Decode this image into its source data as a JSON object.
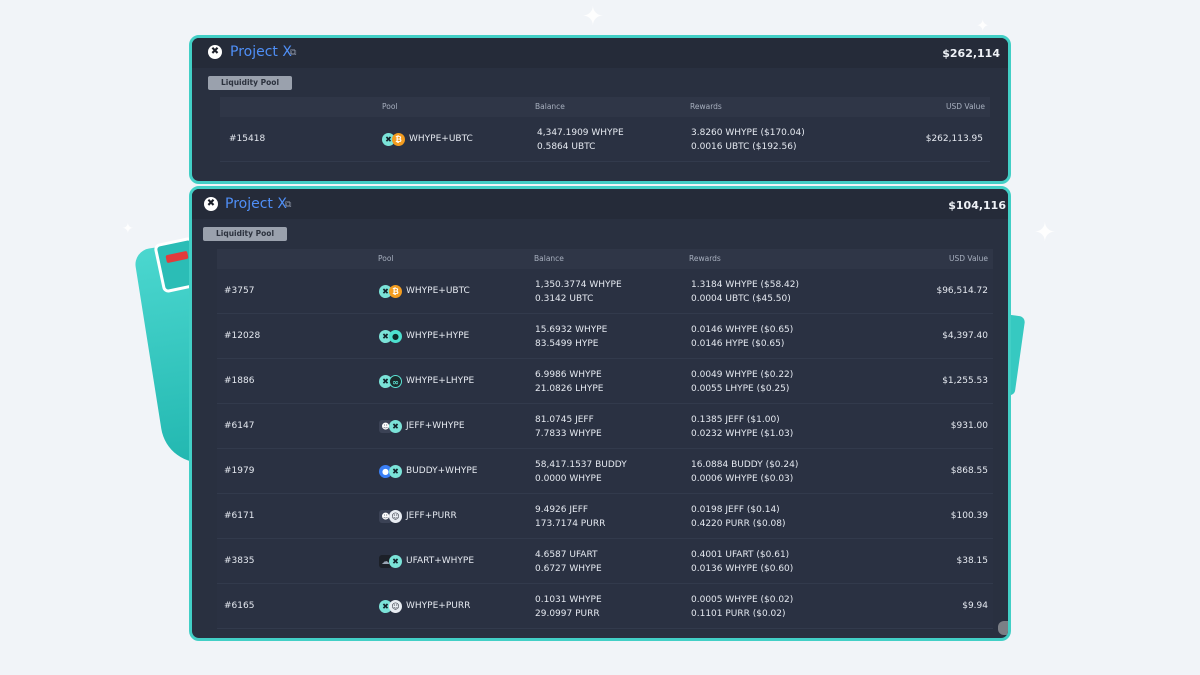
{
  "cards": [
    {
      "project": "Project X",
      "total": "$262,114",
      "section_tag": "Liquidity Pool",
      "columns": {
        "pool": "Pool",
        "balance": "Balance",
        "rewards": "Rewards",
        "usd": "USD Value"
      },
      "rows": [
        {
          "id": "#15418",
          "pool": "WHYPE+UBTC",
          "token_icons": [
            "whype",
            "ubtc"
          ],
          "balance": [
            "4,347.1909 WHYPE",
            "0.5864 UBTC"
          ],
          "rewards": [
            "3.8260 WHYPE ($170.04)",
            "0.0016 UBTC ($192.56)"
          ],
          "usd": "$262,113.95"
        }
      ]
    },
    {
      "project": "Project X",
      "total": "$104,116",
      "section_tag": "Liquidity Pool",
      "columns": {
        "pool": "Pool",
        "balance": "Balance",
        "rewards": "Rewards",
        "usd": "USD Value"
      },
      "rows": [
        {
          "id": "#3757",
          "pool": "WHYPE+UBTC",
          "token_icons": [
            "whype",
            "ubtc"
          ],
          "balance": [
            "1,350.3774 WHYPE",
            "0.3142 UBTC"
          ],
          "rewards": [
            "1.3184 WHYPE ($58.42)",
            "0.0004 UBTC ($45.50)"
          ],
          "usd": "$96,514.72"
        },
        {
          "id": "#12028",
          "pool": "WHYPE+HYPE",
          "token_icons": [
            "whype",
            "hype"
          ],
          "balance": [
            "15.6932 WHYPE",
            "83.5499 HYPE"
          ],
          "rewards": [
            "0.0146 WHYPE ($0.65)",
            "0.0146 HYPE ($0.65)"
          ],
          "usd": "$4,397.40"
        },
        {
          "id": "#1886",
          "pool": "WHYPE+LHYPE",
          "token_icons": [
            "whype",
            "lhype"
          ],
          "balance": [
            "6.9986 WHYPE",
            "21.0826 LHYPE"
          ],
          "rewards": [
            "0.0049 WHYPE ($0.22)",
            "0.0055 LHYPE ($0.25)"
          ],
          "usd": "$1,255.53"
        },
        {
          "id": "#6147",
          "pool": "JEFF+WHYPE",
          "token_icons": [
            "jeff",
            "whype"
          ],
          "balance": [
            "81.0745 JEFF",
            "7.7833 WHYPE"
          ],
          "rewards": [
            "0.1385 JEFF ($1.00)",
            "0.0232 WHYPE ($1.03)"
          ],
          "usd": "$931.00"
        },
        {
          "id": "#1979",
          "pool": "BUDDY+WHYPE",
          "token_icons": [
            "buddy",
            "whype"
          ],
          "balance": [
            "58,417.1537 BUDDY",
            "0.0000 WHYPE"
          ],
          "rewards": [
            "16.0884 BUDDY ($0.24)",
            "0.0006 WHYPE ($0.03)"
          ],
          "usd": "$868.55"
        },
        {
          "id": "#6171",
          "pool": "JEFF+PURR",
          "token_icons": [
            "jeff",
            "purr"
          ],
          "balance": [
            "9.4926 JEFF",
            "173.7174 PURR"
          ],
          "rewards": [
            "0.0198 JEFF ($0.14)",
            "0.4220 PURR ($0.08)"
          ],
          "usd": "$100.39"
        },
        {
          "id": "#3835",
          "pool": "UFART+WHYPE",
          "token_icons": [
            "ufart",
            "whype"
          ],
          "balance": [
            "4.6587 UFART",
            "0.6727 WHYPE"
          ],
          "rewards": [
            "0.4001 UFART ($0.61)",
            "0.0136 WHYPE ($0.60)"
          ],
          "usd": "$38.15"
        },
        {
          "id": "#6165",
          "pool": "WHYPE+PURR",
          "token_icons": [
            "whype",
            "purr"
          ],
          "balance": [
            "0.1031 WHYPE",
            "29.0997 PURR"
          ],
          "rewards": [
            "0.0005 WHYPE ($0.02)",
            "0.1101 PURR ($0.02)"
          ],
          "usd": "$9.94"
        }
      ]
    }
  ],
  "icon_glyphs": {
    "project": "✖",
    "external_link": "⧉"
  },
  "colors": {
    "accent": "#42cfc6",
    "link": "#4f8ff7",
    "card_bg": "#293040"
  }
}
